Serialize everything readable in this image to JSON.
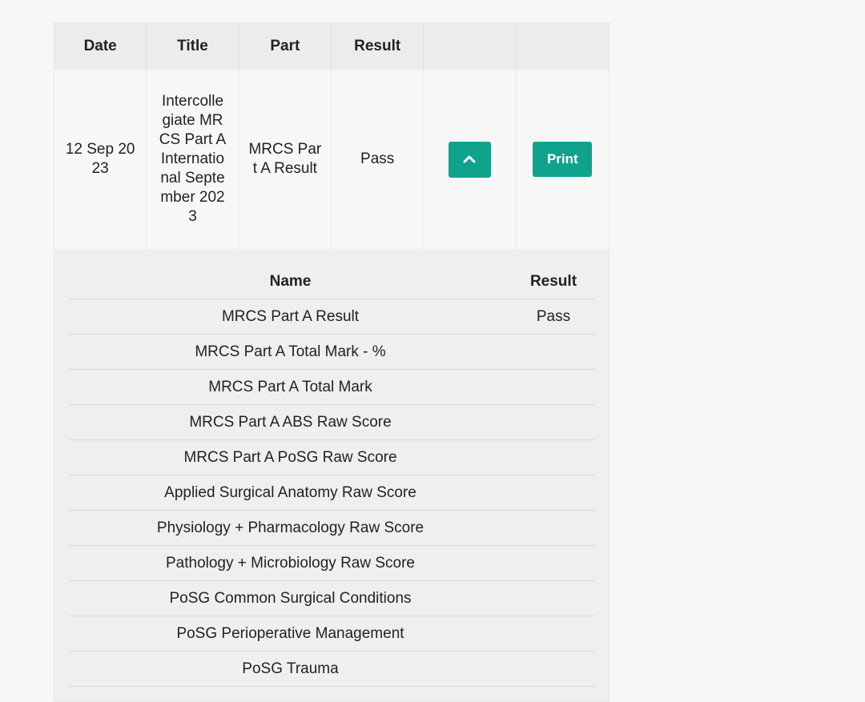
{
  "table": {
    "headers": [
      "Date",
      "Title",
      "Part",
      "Result",
      "",
      ""
    ],
    "row": {
      "date": "12 Sep 2023",
      "title": "Intercollegiate MRCS Part A International September 2023",
      "part": "MRCS Part A Result",
      "result": "Pass",
      "toggle_icon": "chevron-up-icon",
      "print_label": "Print"
    }
  },
  "detail": {
    "headers": {
      "name": "Name",
      "result": "Result"
    },
    "rows": [
      {
        "name": "MRCS Part A Result",
        "result": "Pass"
      },
      {
        "name": "MRCS Part A Total Mark - %",
        "result": ""
      },
      {
        "name": "MRCS Part A Total Mark",
        "result": ""
      },
      {
        "name": "MRCS Part A ABS Raw Score",
        "result": ""
      },
      {
        "name": "MRCS Part A PoSG Raw Score",
        "result": ""
      },
      {
        "name": "Applied Surgical Anatomy Raw Score",
        "result": ""
      },
      {
        "name": "Physiology + Pharmacology Raw Score",
        "result": ""
      },
      {
        "name": "Pathology + Microbiology Raw Score",
        "result": ""
      },
      {
        "name": "PoSG Common Surgical Conditions",
        "result": ""
      },
      {
        "name": "PoSG Perioperative Management",
        "result": ""
      },
      {
        "name": "PoSG Trauma",
        "result": ""
      }
    ]
  },
  "colors": {
    "accent": "#0fa38d",
    "background": "#f7f7f7",
    "header_bg": "#ececec",
    "panel_bg": "#efefef"
  }
}
